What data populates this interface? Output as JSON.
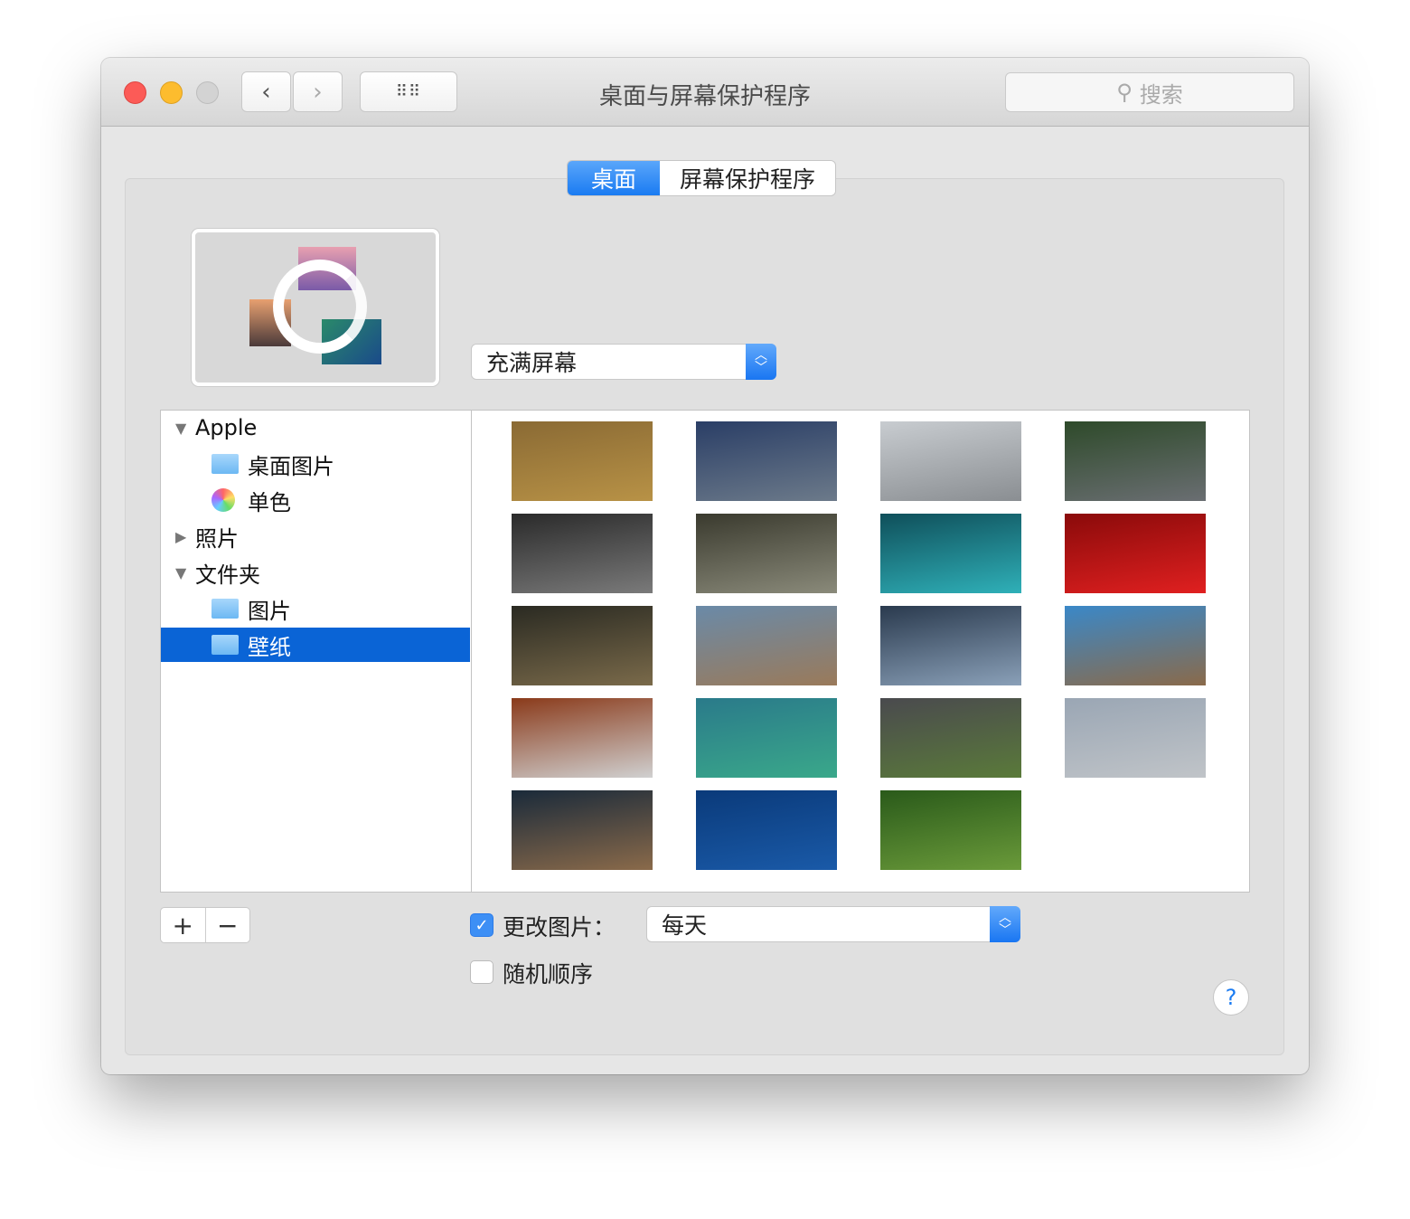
{
  "window": {
    "title": "桌面与屏幕保护程序",
    "search_placeholder": "搜索"
  },
  "tabs": [
    {
      "label": "桌面",
      "selected": true
    },
    {
      "label": "屏幕保护程序",
      "selected": false
    }
  ],
  "fit_select": {
    "value": "充满屏幕"
  },
  "sidebar": {
    "items": [
      {
        "label": "Apple",
        "expanded": true,
        "icon": "triangle-down"
      },
      {
        "label": "桌面图片",
        "icon": "folder-icon"
      },
      {
        "label": "单色",
        "icon": "color-wheel-icon"
      },
      {
        "label": "照片",
        "expanded": false,
        "icon": "triangle-right"
      },
      {
        "label": "文件夹",
        "expanded": true,
        "icon": "triangle-down"
      },
      {
        "label": "图片",
        "icon": "pictures-folder-icon"
      },
      {
        "label": "壁纸",
        "icon": "folder-icon",
        "selected": true
      }
    ]
  },
  "thumbnails": [
    "#8a6a34,#b89246",
    "#2a3e66,#6c7a8a",
    "#c8ccd0,#8a8e92",
    "#2e4a2a,#6a6e72",
    "#2a2a2a,#7a7a7a",
    "#3a3a2e,#8a8a7a",
    "#0f4f5a,#2fb0b8",
    "#8a0a0a,#e02020",
    "#2a2a22,#7a6a4a",
    "#6a8aa8,#9a7a5a",
    "#2a3a4e,#8aa0b8",
    "#3a88c8,#8a6a4a",
    "#8a3a1a,#d0d0d0",
    "#2a7a8a,#3aa88a",
    "#4a4a4e,#5a7a3a",
    "#9aa6b4,#c0c4c8",
    "#1a2a3a,#8a6a4a",
    "#0a3a7a,#1a5aa8",
    "#2a5a1a,#6a9a3a"
  ],
  "bottom": {
    "add": "+",
    "remove": "−",
    "change_picture_label": "更改图片：",
    "change_picture_checked": true,
    "interval_value": "每天",
    "random_label": "随机顺序",
    "random_checked": false,
    "help": "?"
  },
  "colors": {
    "accent": "#1a7bf2",
    "selection": "#0a64d6",
    "close": "#fc5b57",
    "minimize": "#fdbc2e",
    "zoom": "#d0d0d0"
  }
}
